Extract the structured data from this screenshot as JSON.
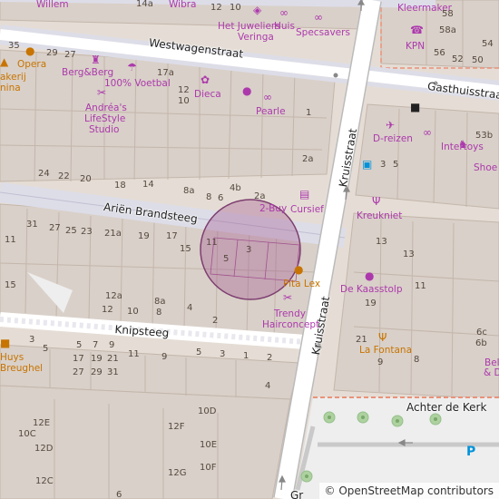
{
  "streets": {
    "westwagenstraat": "Westwagenstraat",
    "gasthuisstraat": "Gasthuisstraat",
    "arien_brandsteeg": "Ariën Brandsteeg",
    "knipsteeg": "Knipsteeg",
    "kruisstraat_upper": "Kruisstraat",
    "kruisstraat_lower": "Kruisstraat",
    "achter_de_kerk": "Achter de Kerk",
    "bottom_partial": "Gr"
  },
  "pois": {
    "willem": "Willem",
    "wibra": "Wibra",
    "het_juweliershuis_1": "Het Juweliers",
    "het_juweliershuis_2": "Huis",
    "veringa": "Veringa",
    "specsavers": "Specsavers",
    "kleermaker": "Kleermaker",
    "kpn": "KPN",
    "opera": "Opera",
    "bakkerij_1": "akerij",
    "bakkerij_2": "nina",
    "berg_berg": "Berg&Berg",
    "voetbal": "100% Voetbal",
    "andreas_1": "Andréa's",
    "andreas_2": "LifeStyle",
    "andreas_3": "Studio",
    "dieca": "Dieca",
    "pearle": "Pearle",
    "d_reizen": "D-reizen",
    "intertoys": "Intertoys",
    "shoe": "Shoe",
    "two_buy": "2-Buy",
    "cursief": "Cursief",
    "kreukniet": "Kreukniet",
    "pita_lex": "Pita Lex",
    "de_kaasstolp": "De Kaasstolp",
    "trendy_1": "Trendy",
    "trendy_2": "Hairconcept",
    "la_fontana": "La Fontana",
    "huys_1": "Huys",
    "huys_2": "Breughel",
    "bel_1": "Bel",
    "bel_2": "& D"
  },
  "house_numbers": {
    "n14a": "14a",
    "n12_top": "12",
    "n10_top": "10",
    "n58": "58",
    "n58a": "58a",
    "n56": "56",
    "n54": "54",
    "n52": "52",
    "n50": "50",
    "n35": "35",
    "n29": "29",
    "n27": "27",
    "n17a": "17a",
    "n12a": "12",
    "n10b": "10",
    "n1": "1",
    "n2a": "2a",
    "n24": "24",
    "n22": "22",
    "n20": "20",
    "n18": "18",
    "n14": "14",
    "n8a": "8a",
    "n8": "8",
    "n6": "6",
    "n4b": "4b",
    "n2a2": "2a",
    "n3": "3",
    "n5a": "5",
    "n53b": "53b",
    "n31": "31",
    "n27b": "27",
    "n25": "25",
    "n23": "23",
    "n21a": "21a",
    "n19": "19",
    "n17": "17",
    "n15": "15",
    "n11": "11",
    "n11b": "11",
    "n5": "5",
    "n3b": "3",
    "n15b": "15",
    "n12ab": "12a",
    "n12": "12",
    "n10": "10",
    "n8ab": "8a",
    "n8b": "8",
    "n4": "4",
    "n2": "2",
    "n13": "13",
    "n13b": "13",
    "n11c": "11",
    "n19b": "19",
    "n21": "21",
    "n9": "9",
    "n3c": "3",
    "n5b": "5",
    "n7": "7",
    "n9b": "9",
    "n11d": "11",
    "n17b": "17",
    "n19c": "19",
    "n21b": "21",
    "n27c": "27",
    "n29b": "29",
    "n31b": "31",
    "n9c": "9",
    "n5c": "5",
    "n3d": "3",
    "n1b": "1",
    "n2b": "2",
    "n4c": "4",
    "n10d": "10D",
    "n12e": "12E",
    "n12f": "12F",
    "n10c": "10C",
    "n10e": "10E",
    "n12d": "12D",
    "n12g": "12G",
    "n10f": "10F",
    "n12c": "12C",
    "n6b": "6",
    "n6c": "6c",
    "n6b2": "6b",
    "n8c": "8"
  },
  "attribution": "© OpenStreetMap contributors",
  "colors": {
    "background": "#e5ddd5",
    "building": "#d9d0c9",
    "building_outline": "#c4b6ab",
    "road": "#ffffff",
    "pedestrian": "#dddde8",
    "poi_text": "#ac39ac",
    "food_poi": "#c77400",
    "parking": "#0092da",
    "highlight_circle": "#a0528c"
  }
}
